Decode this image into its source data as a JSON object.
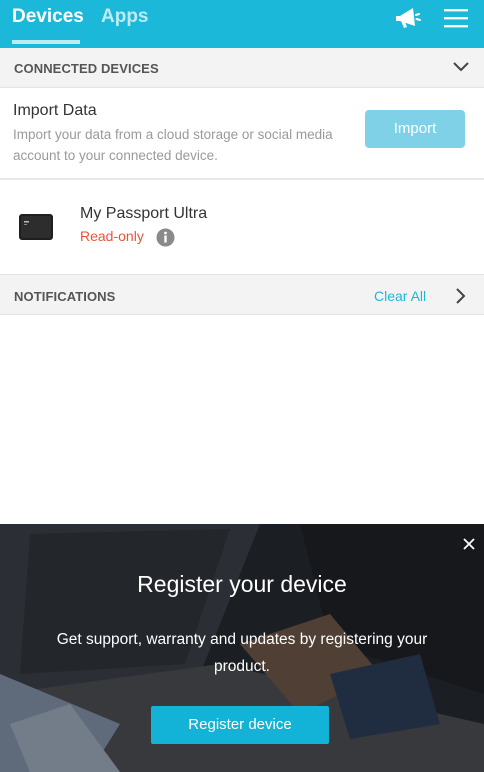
{
  "header": {
    "tabs": [
      {
        "label": "Devices",
        "active": true
      },
      {
        "label": "Apps",
        "active": false
      }
    ],
    "icons": [
      "megaphone-icon",
      "hamburger-menu-icon"
    ],
    "accent_color": "#1cb8d9"
  },
  "connected_devices": {
    "title": "CONNECTED DEVICES",
    "import": {
      "title": "Import Data",
      "description": "Import your data from a cloud storage or social media account to your connected device.",
      "button_label": "Import"
    },
    "devices": [
      {
        "name": "My Passport Ultra",
        "status": "Read-only",
        "status_color": "#e8533c"
      }
    ]
  },
  "notifications": {
    "title": "NOTIFICATIONS",
    "clear_label": "Clear All"
  },
  "promo": {
    "title": "Register your device",
    "text": "Get support, warranty and updates by registering your product.",
    "button_label": "Register device"
  }
}
